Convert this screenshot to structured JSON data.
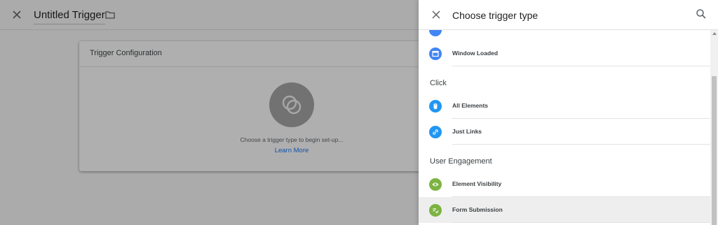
{
  "editor": {
    "title": "Untitled Trigger",
    "close_icon": "close-icon",
    "folder_icon": "folder-icon"
  },
  "config_card": {
    "title": "Trigger Configuration",
    "hint": "Choose a trigger type to begin set-up...",
    "learn_more": "Learn More",
    "icon": "trigger-placeholder-icon"
  },
  "panel": {
    "title": "Choose trigger type",
    "close_icon": "close-icon",
    "search_icon": "search-icon",
    "items": [
      {
        "label": "Window Loaded",
        "icon": "window-icon",
        "color": "#4285f4"
      },
      {
        "label": "All Elements",
        "icon": "mouse-icon",
        "color": "#2196f3"
      },
      {
        "label": "Just Links",
        "icon": "link-icon",
        "color": "#2196f3"
      },
      {
        "label": "Element Visibility",
        "icon": "eye-icon",
        "color": "#7cb342"
      },
      {
        "label": "Form Submission",
        "icon": "form-icon",
        "color": "#7cb342"
      }
    ],
    "sections": {
      "click": "Click",
      "user_engagement": "User Engagement"
    }
  },
  "colors": {
    "accent": "#1a73e8",
    "blue_icon": "#4285f4",
    "green_icon": "#7cb342"
  }
}
